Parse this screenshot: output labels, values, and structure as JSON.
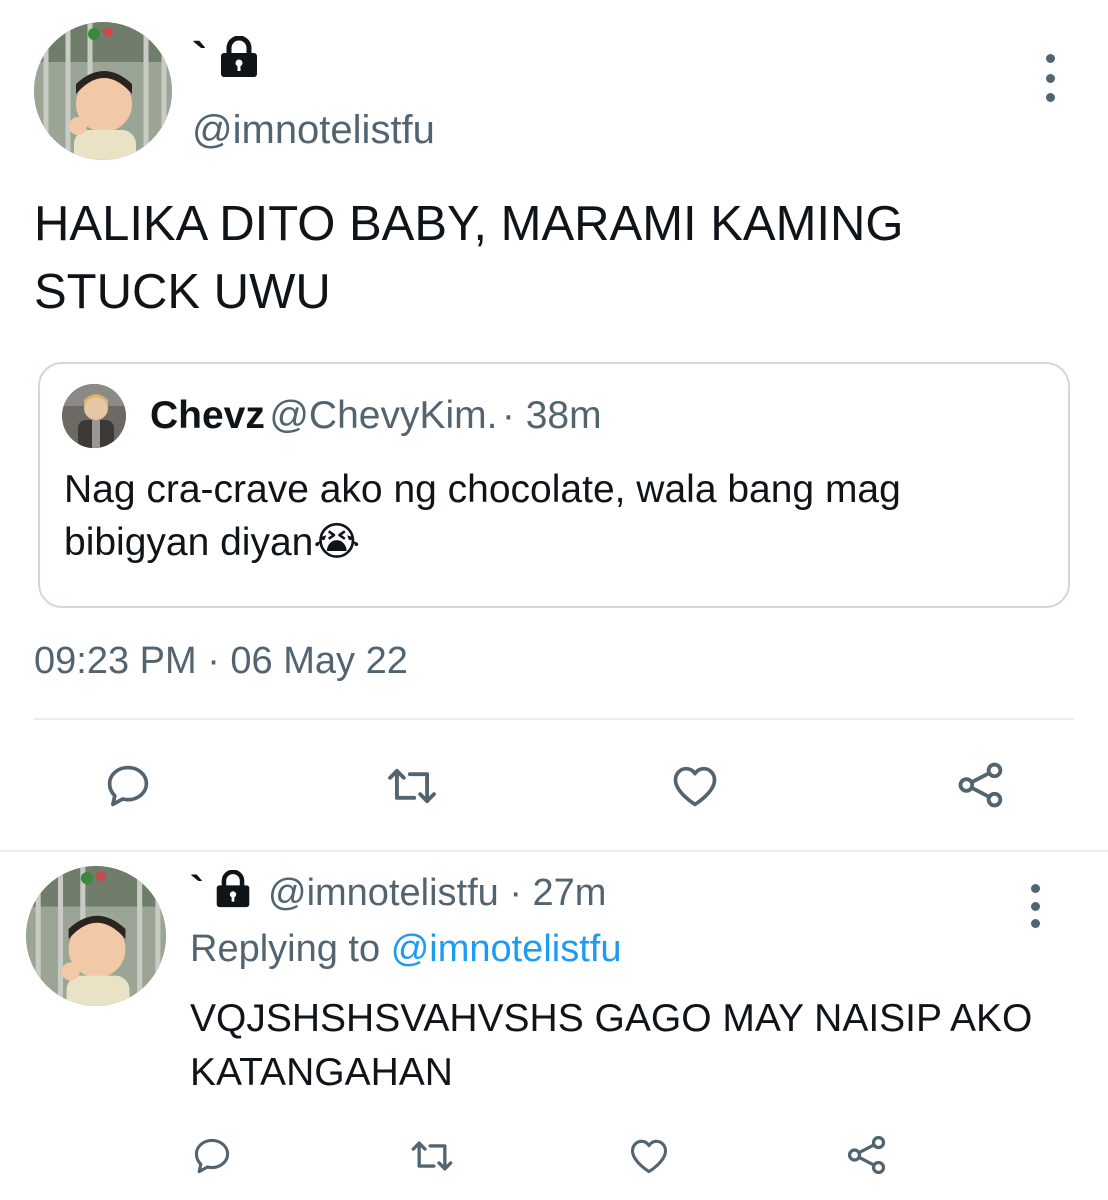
{
  "main_tweet": {
    "display_name": "`",
    "handle": "@imnotelistfu",
    "text": "HALIKA DITO BABY, MARAMI KAMING STUCK UWU",
    "timestamp": "09:23 PM · 06 May 22",
    "icons": {
      "protected": "lock-icon",
      "menu": "more-vertical-icon"
    }
  },
  "quote": {
    "name": "Chevz",
    "handle": "@ChevyKim.",
    "time": "· 38m",
    "text": "Nag cra-crave ako ng chocolate, wala bang mag bibigyan diyan",
    "emoji": "😭"
  },
  "actions": {
    "icons": [
      "reply-icon",
      "retweet-icon",
      "like-icon",
      "share-icon"
    ]
  },
  "reply_tweet": {
    "display_name": "`",
    "handle": "@imnotelistfu",
    "time": "· 27m",
    "replying_prefix": "Replying to",
    "replying_handle": "@imnotelistfu",
    "text": "VQJSHSHSVAHVSHS GAGO MAY NAISIP AKO KATANGAHAN"
  },
  "colors": {
    "text": "#0f1419",
    "secondary": "#536471",
    "link": "#1d9bf0",
    "border": "#cfd9de",
    "divider": "#e6ecf0"
  }
}
